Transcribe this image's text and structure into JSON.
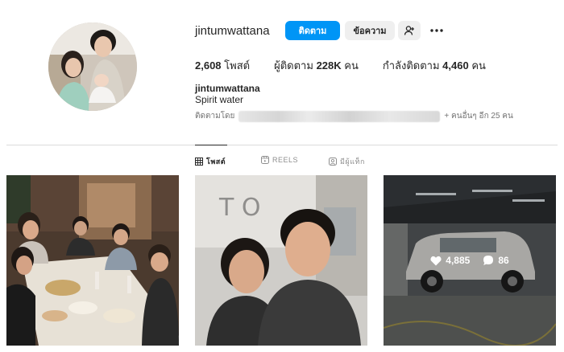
{
  "profile": {
    "username": "jintumwattana",
    "fullname": "jintumwattana",
    "bio": "Spirit water",
    "buttons": {
      "follow": "ติดตาม",
      "message": "ข้อความ"
    },
    "stats": {
      "posts": "2,608",
      "posts_label": "โพสต์",
      "followers_label": "ผู้ติดตาม",
      "followers": "228K",
      "followers_unit": "คน",
      "following_label": "กำลังติดตาม",
      "following": "4,460",
      "following_unit": "คน"
    },
    "followed_by_prefix": "ติดตามโดย",
    "followed_by_suffix": "+ คนอื่นๆ อีก 25 คน"
  },
  "tabs": [
    {
      "label": "โพสต์",
      "icon": "grid-icon",
      "active": true
    },
    {
      "label": "REELS",
      "icon": "reels-icon",
      "active": false
    },
    {
      "label": "มีผู้แท็ก",
      "icon": "tagged-icon",
      "active": false
    }
  ],
  "posts": [
    {
      "kind": "dinner-photo"
    },
    {
      "kind": "selfie-photo"
    },
    {
      "kind": "car-photo",
      "likes": "4,885",
      "comments": "86"
    }
  ],
  "colors": {
    "accent": "#0095f6",
    "secondary_button": "#efefef",
    "text": "#262626",
    "muted": "#737373"
  }
}
